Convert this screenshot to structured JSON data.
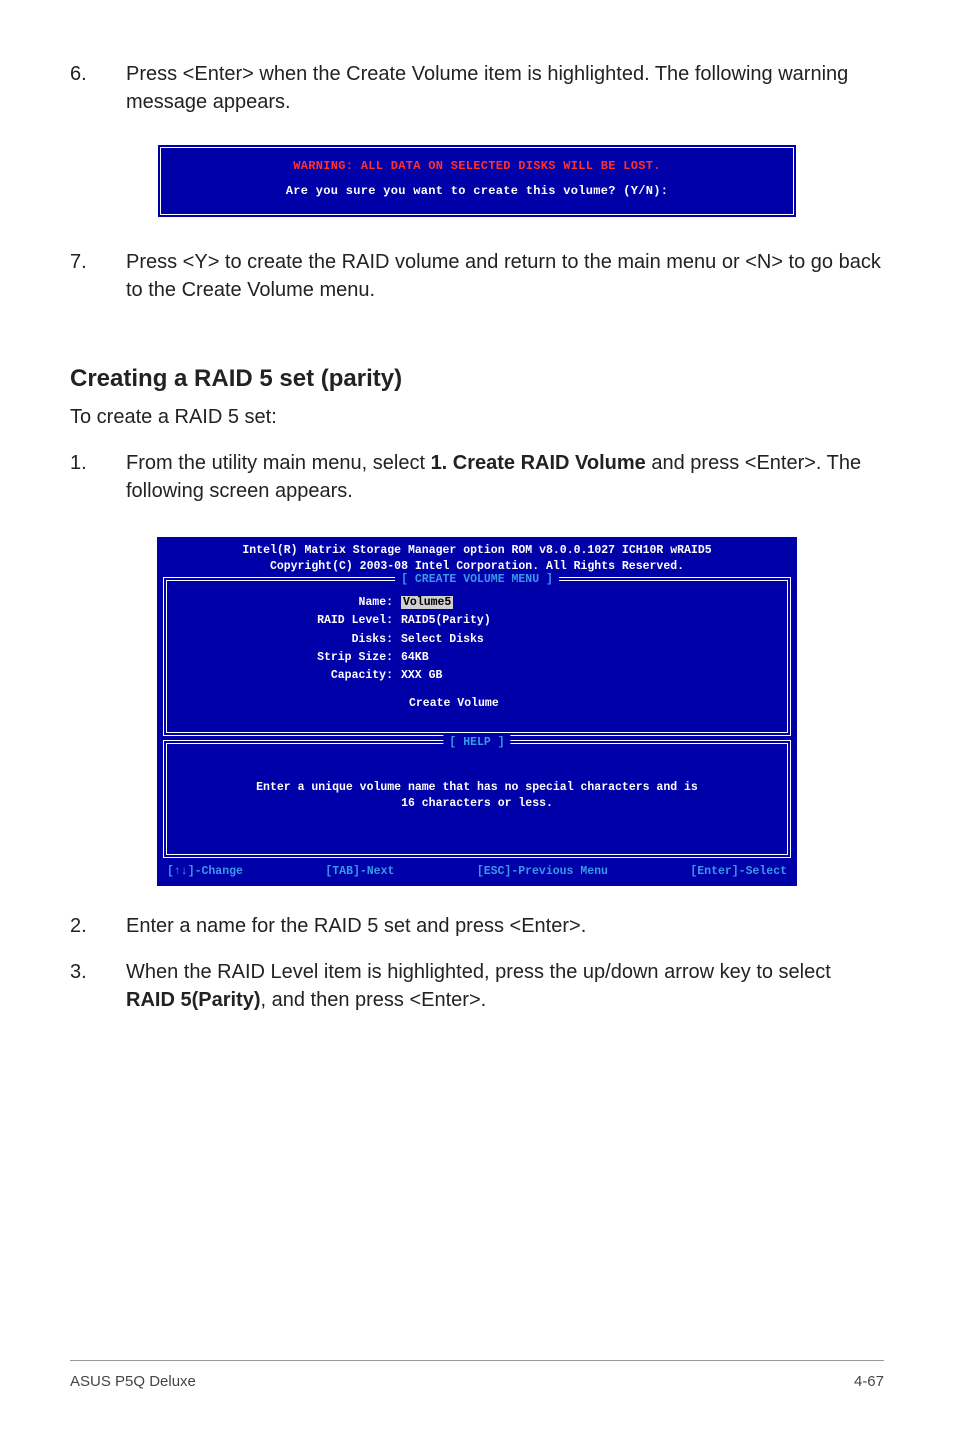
{
  "steps_top": [
    {
      "num": "6.",
      "text": "Press <Enter> when the Create Volume item is highlighted. The following warning message appears."
    }
  ],
  "warn_box": {
    "warning": "WARNING: ALL DATA ON SELECTED DISKS WILL BE LOST.",
    "prompt": "Are you sure you want to create this volume? (Y/N):"
  },
  "steps_mid": [
    {
      "num": "7.",
      "text": "Press <Y> to create the RAID volume and return to the main menu or <N> to go back to the Create Volume menu."
    }
  ],
  "section_heading": "Creating a RAID 5 set (parity)",
  "section_lead": "To create a RAID 5 set:",
  "steps_create": [
    {
      "num": "1.",
      "pre": "From the utility main menu, select ",
      "bold": "1. Create RAID Volume",
      "post": " and press <Enter>. The following screen appears."
    }
  ],
  "util": {
    "title1": "Intel(R) Matrix Storage Manager option ROM v8.0.0.1027 ICH10R wRAID5",
    "title2": "Copyright(C) 2003-08 Intel Corporation. All Rights Reserved.",
    "panel1_title": "[ CREATE VOLUME MENU ]",
    "fields": {
      "name_label": "Name:",
      "name_value": "Volume5",
      "raid_label": "RAID Level:",
      "raid_value": "RAID5(Parity)",
      "disks_label": "Disks:",
      "disks_value": "Select Disks",
      "strip_label": "Strip Size:",
      "strip_value": "64KB",
      "cap_label": "Capacity:",
      "cap_value": "XXX   GB"
    },
    "create_volume": "Create Volume",
    "panel2_title": "[ HELP ]",
    "help_line1": "Enter a unique volume name that has no special characters and is",
    "help_line2": "16 characters or less.",
    "status": {
      "change": "[↑↓]-Change",
      "next": "[TAB]-Next",
      "prev": "[ESC]-Previous Menu",
      "select": "[Enter]-Select"
    }
  },
  "steps_bottom": [
    {
      "num": "2.",
      "text": "Enter a name for the RAID 5 set and press <Enter>."
    },
    {
      "num": "3.",
      "pre": "When the RAID Level item is highlighted, press the up/down arrow key to select ",
      "bold": "RAID 5(Parity)",
      "post": ", and then press <Enter>."
    }
  ],
  "footer": {
    "left": "ASUS P5Q Deluxe",
    "right": "4-67"
  }
}
